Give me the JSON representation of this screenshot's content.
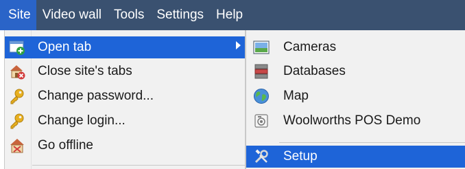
{
  "menubar": {
    "items": [
      {
        "label": "Site",
        "active": true
      },
      {
        "label": "Video wall"
      },
      {
        "label": "Tools"
      },
      {
        "label": "Settings"
      },
      {
        "label": "Help"
      }
    ]
  },
  "site_menu": {
    "items": [
      {
        "label": "Open tab",
        "icon": "open-tab-icon",
        "highlighted": true,
        "has_submenu": true
      },
      {
        "label": "Close site's tabs",
        "icon": "close-site-tabs-icon"
      },
      {
        "label": "Change password...",
        "icon": "key-icon"
      },
      {
        "label": "Change login...",
        "icon": "key-icon"
      },
      {
        "label": "Go offline",
        "icon": "go-offline-icon"
      }
    ]
  },
  "open_tab_submenu": {
    "items": [
      {
        "label": "Cameras",
        "icon": "cameras-icon"
      },
      {
        "label": "Databases",
        "icon": "databases-icon"
      },
      {
        "label": "Map",
        "icon": "globe-icon"
      },
      {
        "label": "Woolworths POS Demo",
        "icon": "pos-demo-icon"
      },
      {
        "label": "Setup",
        "icon": "setup-tools-icon",
        "highlighted": true
      }
    ]
  },
  "colors": {
    "menubar_bg": "#3a5170",
    "highlight": "#1e64d8",
    "menu_bg": "#f1f1f1"
  }
}
